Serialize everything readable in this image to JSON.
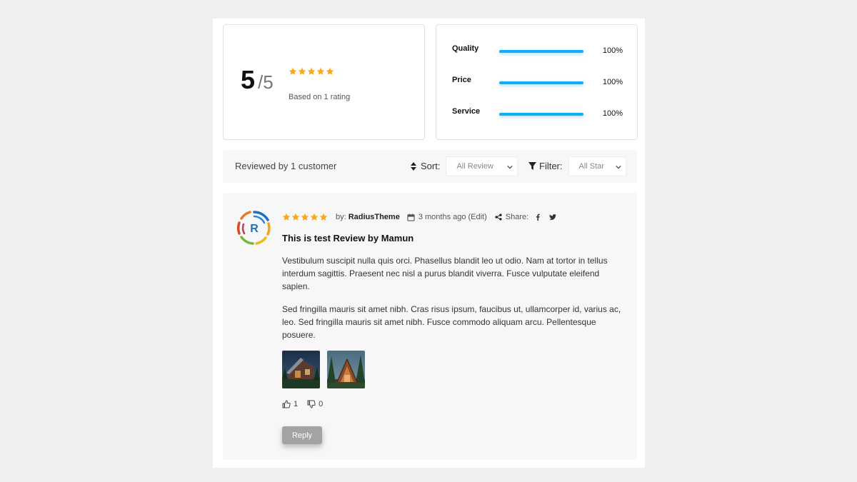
{
  "summary": {
    "score": "5",
    "score_max": "/5",
    "stars": 5,
    "based_on": "Based on 1 rating"
  },
  "criteria": [
    {
      "label": "Quality",
      "value": 100,
      "percent_text": "100%"
    },
    {
      "label": "Price",
      "value": 100,
      "percent_text": "100%"
    },
    {
      "label": "Service",
      "value": 100,
      "percent_text": "100%"
    }
  ],
  "toolbar": {
    "reviewed_by": "Reviewed by 1 customer",
    "sort_label": "Sort:",
    "sort_value": "All Review",
    "filter_label": "Filter:",
    "filter_value": "All Star"
  },
  "review": {
    "avatar_letter": "R",
    "stars": 5,
    "by_label": "by:",
    "author": "RadiusTheme",
    "date": "3 months ago",
    "edit_label": "(Edit)",
    "share_label": "Share:",
    "title": "This is test Review by Mamun",
    "paragraphs": [
      "Vestibulum suscipit nulla quis orci. Phasellus blandit leo ut odio. Nam at tortor in tellus interdum sagittis. Praesent nec nisl a purus blandit viverra. Fusce vulputate eleifend sapien.",
      "Sed fringilla mauris sit amet nibh. Cras risus ipsum, faucibus ut, ullamcorper id, varius ac, leo. Sed fringilla mauris sit amet nibh. Fusce commodo aliquam arcu. Pellentesque posuere."
    ],
    "likes": "1",
    "dislikes": "0",
    "reply_label": "Reply"
  },
  "colors": {
    "star": "#f8a81a",
    "bar": "#0fb0f5",
    "reply_button": "#a3a3a3"
  }
}
